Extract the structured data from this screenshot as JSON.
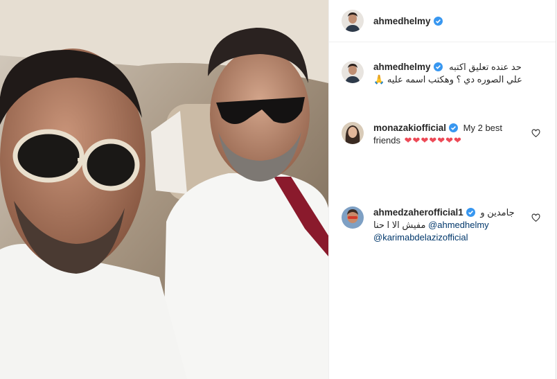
{
  "post": {
    "username": "ahmedhelmy",
    "verified": true
  },
  "comments": [
    {
      "username": "ahmedhelmy",
      "verified": true,
      "line1": "حد عنده تعليق اكتبه",
      "line2": "علي الصوره دي ؟ وهكتب اسمه عليه",
      "emoji": "🙏"
    },
    {
      "username": "monazakiofficial",
      "verified": true,
      "text_inline": "My 2 best",
      "text_line2": "friends",
      "hearts": "❤❤❤❤❤❤❤"
    },
    {
      "username": "ahmedzaherofficial1",
      "verified": true,
      "text_inline": "جامدين و",
      "mention1": "@ahmedhelmy",
      "text_mid": "مفيش الا ا حنا",
      "mention2": "@karimabdelazizofficial"
    }
  ],
  "icons": {
    "verified": "verified-badge-icon",
    "like": "heart-outline-icon"
  },
  "colors": {
    "verified": "#3897f0",
    "mention": "#00376b",
    "heart": "#ed4956"
  }
}
